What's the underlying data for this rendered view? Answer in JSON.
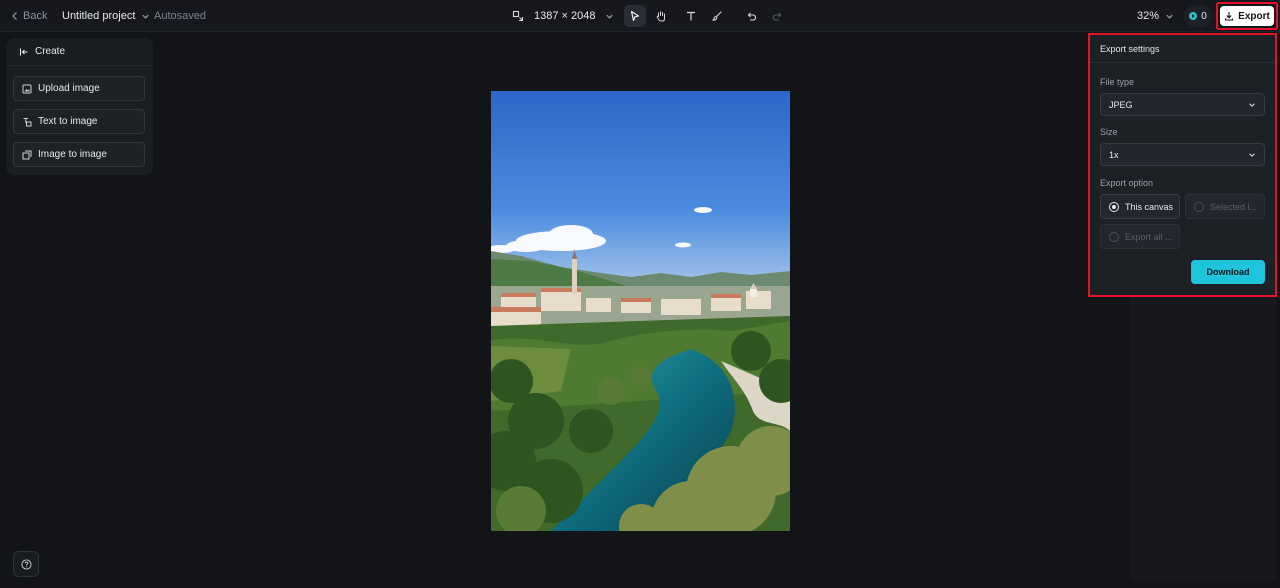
{
  "topbar": {
    "back_label": "Back",
    "project_name": "Untitled project",
    "save_status": "Autosaved",
    "canvas_size": "1387 × 2048",
    "zoom": "32%",
    "credits": "0",
    "export_label": "Export"
  },
  "create_panel": {
    "title": "Create",
    "items": [
      {
        "label": "Upload image",
        "icon": "upload-image-icon"
      },
      {
        "label": "Text to image",
        "icon": "text-to-image-icon"
      },
      {
        "label": "Image to image",
        "icon": "image-to-image-icon"
      }
    ]
  },
  "export_panel": {
    "title": "Export settings",
    "file_type_label": "File type",
    "file_type_value": "JPEG",
    "size_label": "Size",
    "size_value": "1x",
    "option_label": "Export option",
    "options": [
      {
        "label": "This canvas",
        "selected": true,
        "enabled": true
      },
      {
        "label": "Selected l...",
        "selected": false,
        "enabled": false
      },
      {
        "label": "Export all ...",
        "selected": false,
        "enabled": false
      }
    ],
    "download_label": "Download"
  },
  "colors": {
    "accent": "#1ec3dc",
    "highlight": "#e0152a",
    "background": "#121418"
  }
}
